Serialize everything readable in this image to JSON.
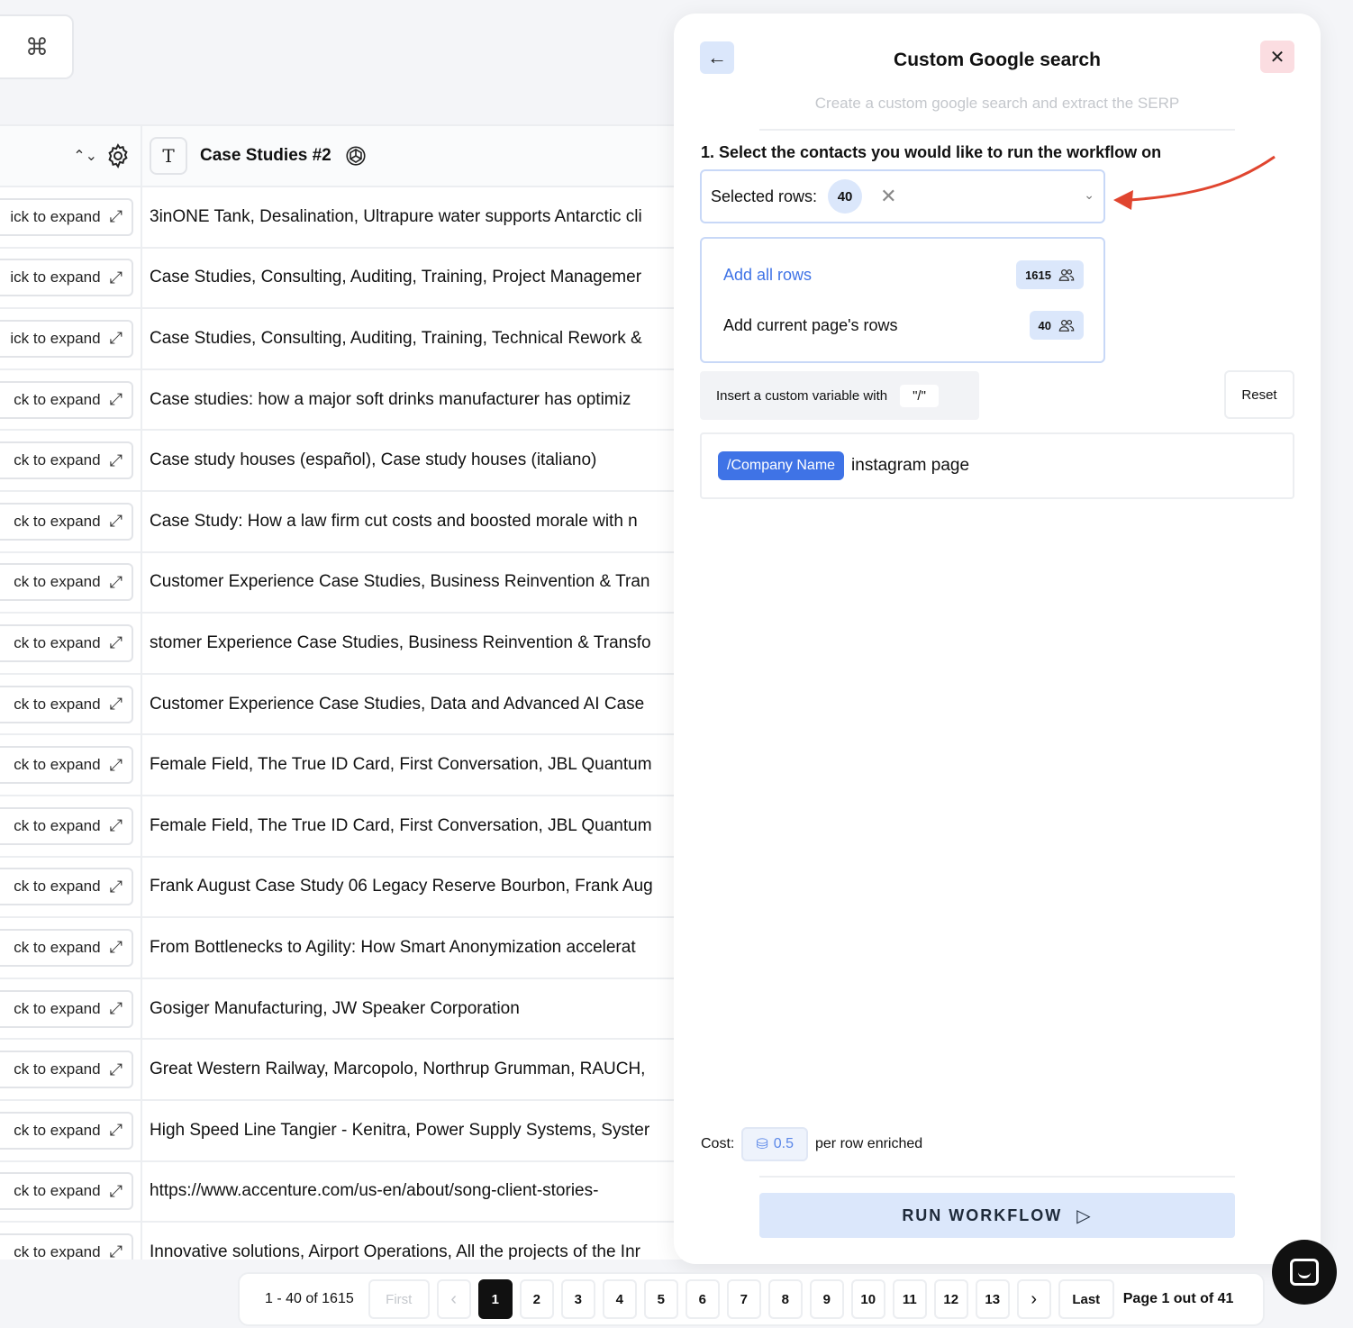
{
  "cmd_box": {
    "glyph": "⌘"
  },
  "table": {
    "header": {
      "sort_glyph": "⌃⌄",
      "type_glyph": "T",
      "column_title": "Case Studies #2"
    },
    "rows": [
      {
        "expand_label": "ick to expand",
        "value": "3inONE Tank, Desalination, Ultrapure water supports Antarctic cli"
      },
      {
        "expand_label": "ick to expand",
        "value": "Case Studies, Consulting, Auditing, Training, Project Managemer"
      },
      {
        "expand_label": "ick to expand",
        "value": "Case Studies, Consulting, Auditing, Training, Technical Rework &"
      },
      {
        "expand_label": "ck to expand",
        "value": "Case studies: how a major soft drinks manufacturer has optimiz"
      },
      {
        "expand_label": "ck to expand",
        "value": "Case study houses (español), Case study houses (italiano)"
      },
      {
        "expand_label": "ck to expand",
        "value": "Case Study: How a law firm cut costs and boosted morale with n"
      },
      {
        "expand_label": "ck to expand",
        "value": "Customer Experience Case Studies, Business Reinvention & Tran"
      },
      {
        "expand_label": "ck to expand",
        "value": "stomer Experience Case Studies, Business Reinvention & Transfo"
      },
      {
        "expand_label": "ck to expand",
        "value": "Customer Experience Case Studies, Data and Advanced AI Case"
      },
      {
        "expand_label": "ck to expand",
        "value": "Female Field, The True ID Card, First Conversation, JBL Quantum"
      },
      {
        "expand_label": "ck to expand",
        "value": "Female Field, The True ID Card, First Conversation, JBL Quantum"
      },
      {
        "expand_label": "ck to expand",
        "value": "Frank August Case Study 06 Legacy Reserve Bourbon, Frank Aug"
      },
      {
        "expand_label": "ck to expand",
        "value": "From Bottlenecks to Agility: How Smart Anonymization accelerat"
      },
      {
        "expand_label": "ck to expand",
        "value": "Gosiger Manufacturing, JW Speaker Corporation"
      },
      {
        "expand_label": "ck to expand",
        "value": "Great Western Railway, Marcopolo, Northrup Grumman, RAUCH,"
      },
      {
        "expand_label": "ck to expand",
        "value": "High Speed Line Tangier - Kenitra, Power Supply Systems, Syster"
      },
      {
        "expand_label": "ck to expand",
        "value": "https://www.accenture.com/us-en/about/song-client-stories-"
      },
      {
        "expand_label": "ck to expand",
        "value": "Innovative solutions, Airport Operations, All the projects of the Inr"
      }
    ]
  },
  "panel": {
    "back_glyph": "←",
    "close_glyph": "✕",
    "title": "Custom Google search",
    "subtitle": "Create a custom google search and extract the SERP",
    "step_label": "1. Select the contacts you would like to run the workflow on",
    "select": {
      "label": "Selected rows:",
      "count": "40",
      "clear_glyph": "✕",
      "chevron_glyph": "⌄"
    },
    "dropdown": {
      "options": [
        {
          "label": "Add all rows",
          "badge": "1615"
        },
        {
          "label": "Add current page's rows",
          "badge": "40"
        }
      ],
      "people_glyph": "👥"
    },
    "variable_hint": {
      "text": "Insert a custom variable with",
      "key": "\"/\""
    },
    "reset_label": "Reset",
    "editor": {
      "chip": "/Company Name",
      "text": "instagram page"
    },
    "cost": {
      "label": "Cost:",
      "coin_glyph": "⛁",
      "value": "0.5",
      "suffix": "per row enriched"
    },
    "run_label": "RUN WORKFLOW",
    "run_glyph": "▷"
  },
  "pagination": {
    "range": "1 - 40 of 1615",
    "first": "First",
    "prev_glyph": "‹",
    "pages": [
      "1",
      "2",
      "3",
      "4",
      "5",
      "6",
      "7",
      "8",
      "9",
      "10",
      "11",
      "12",
      "13"
    ],
    "current": "1",
    "next_glyph": "›",
    "last": "Last",
    "page_label": "Page 1 out of 41"
  },
  "colors": {
    "accent": "#3f73e6",
    "accent_light": "#dbe7fb",
    "arrow": "#e0452f"
  }
}
